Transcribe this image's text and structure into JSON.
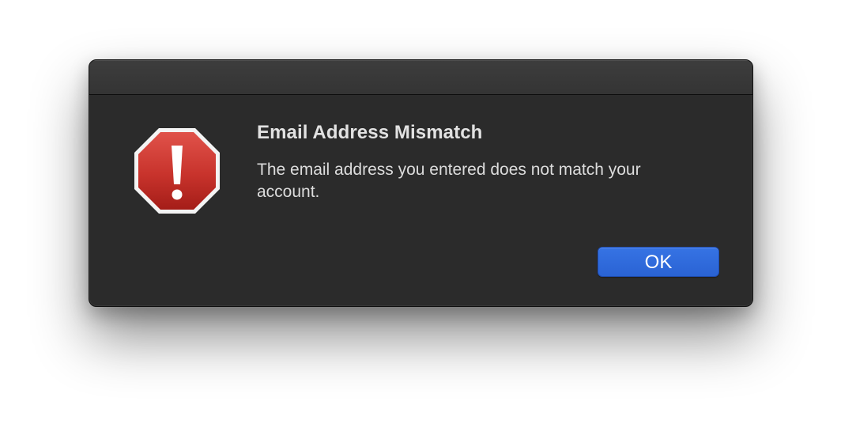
{
  "dialog": {
    "title": "Email Address Mismatch",
    "message": "The email address you entered does not match your account.",
    "icon": "stop-alert-icon",
    "ok_label": "OK"
  },
  "colors": {
    "window_background": "#2b2b2b",
    "titlebar": "#393939",
    "button_accent": "#2f6be0",
    "alert_red": "#c8332c"
  }
}
